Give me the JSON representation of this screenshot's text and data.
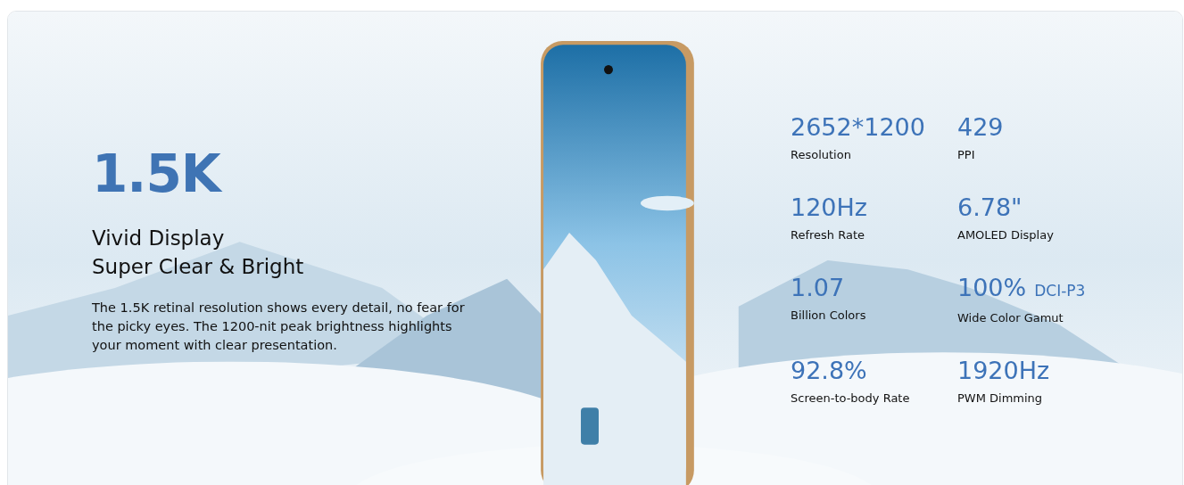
{
  "headline": "1.5K",
  "titles": [
    "Vivid Display",
    "Super Clear & Bright"
  ],
  "description": "The 1.5K retinal resolution shows every detail, no fear for the picky eyes. The 1200-nit peak brightness highlights your moment with clear presentation.",
  "specs": [
    {
      "value": "2652*1200",
      "label": "Resolution"
    },
    {
      "value": "429",
      "label": "PPI"
    },
    {
      "value": "120Hz",
      "label": "Refresh Rate"
    },
    {
      "value": "6.78\"",
      "label": "AMOLED Display"
    },
    {
      "value": "1.07",
      "label": "Billion Colors"
    },
    {
      "value": "100%",
      "suffix": "DCI-P3",
      "label": "Wide Color Gamut"
    },
    {
      "value": "92.8%",
      "label": "Screen-to-body Rate"
    },
    {
      "value": "1920Hz",
      "label": "PWM Dimming"
    }
  ]
}
